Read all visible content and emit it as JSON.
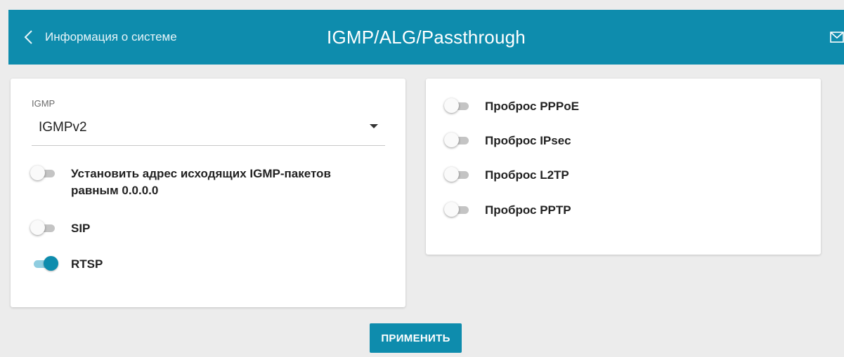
{
  "header": {
    "back_label": "Информация о системе",
    "title": "IGMP/ALG/Passthrough",
    "mail_icon": "envelope-icon"
  },
  "igmp": {
    "label": "IGMP",
    "selected": "IGMPv2"
  },
  "left_toggles": [
    {
      "label": "Установить адрес исходящих IGMP-пакетов\nравным 0.0.0.0",
      "on": false
    },
    {
      "label": "SIP",
      "on": false
    },
    {
      "label": "RTSP",
      "on": true
    }
  ],
  "right_toggles": [
    {
      "label": "Проброс PPPoE",
      "on": false
    },
    {
      "label": "Проброс IPsec",
      "on": false
    },
    {
      "label": "Проброс L2TP",
      "on": false
    },
    {
      "label": "Проброс PPTP",
      "on": false
    }
  ],
  "apply_label": "ПРИМЕНИТЬ",
  "colors": {
    "accent": "#0e8cad",
    "background": "#ececec",
    "toggle_on_track": "#8fcde0",
    "toggle_off_track": "#c4c4c4"
  }
}
